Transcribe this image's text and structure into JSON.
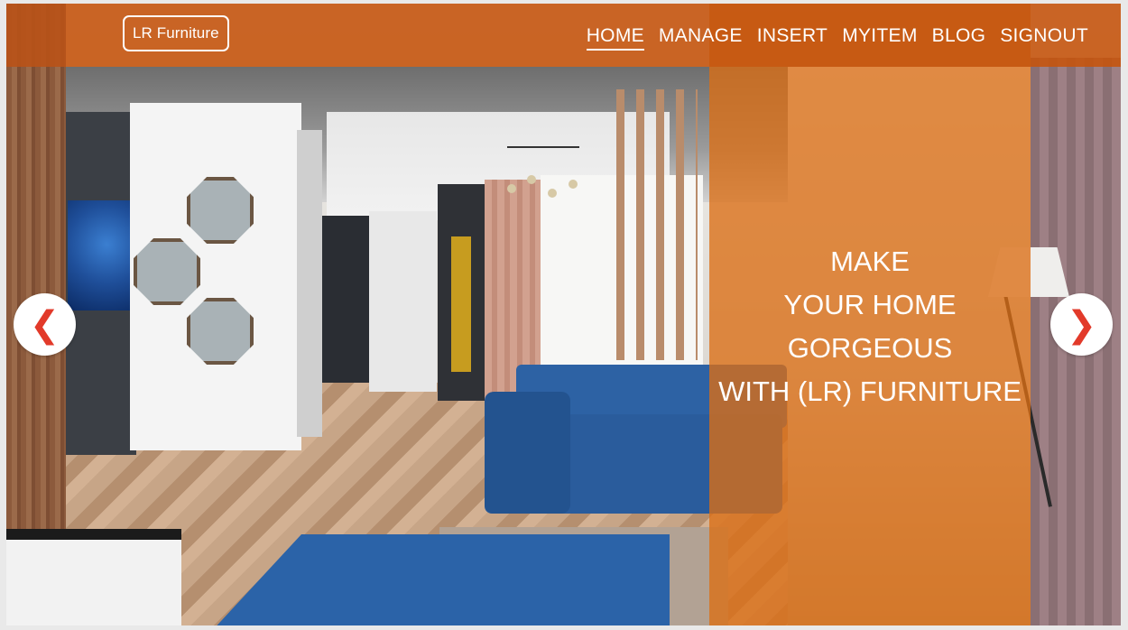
{
  "brand": {
    "label": "LR Furniture"
  },
  "nav": {
    "items": [
      {
        "label": "HOME",
        "active": true
      },
      {
        "label": "MANAGE"
      },
      {
        "label": "INSERT"
      },
      {
        "label": "MYITEM"
      },
      {
        "label": "BLOG"
      },
      {
        "label": "SIGNOUT"
      }
    ]
  },
  "hero": {
    "lines": [
      "MAKE",
      "YOUR HOME",
      "GORGEOUS",
      "WITH (LR) FURNITURE"
    ]
  },
  "carousel": {
    "prev_icon": "chevron-left-icon",
    "next_icon": "chevron-right-icon",
    "prev_glyph": "❮",
    "next_glyph": "❯"
  },
  "colors": {
    "navbar": "#c4540e",
    "panel": "#db6e14",
    "arrow": "#e23a2a",
    "text": "#ffffff"
  }
}
